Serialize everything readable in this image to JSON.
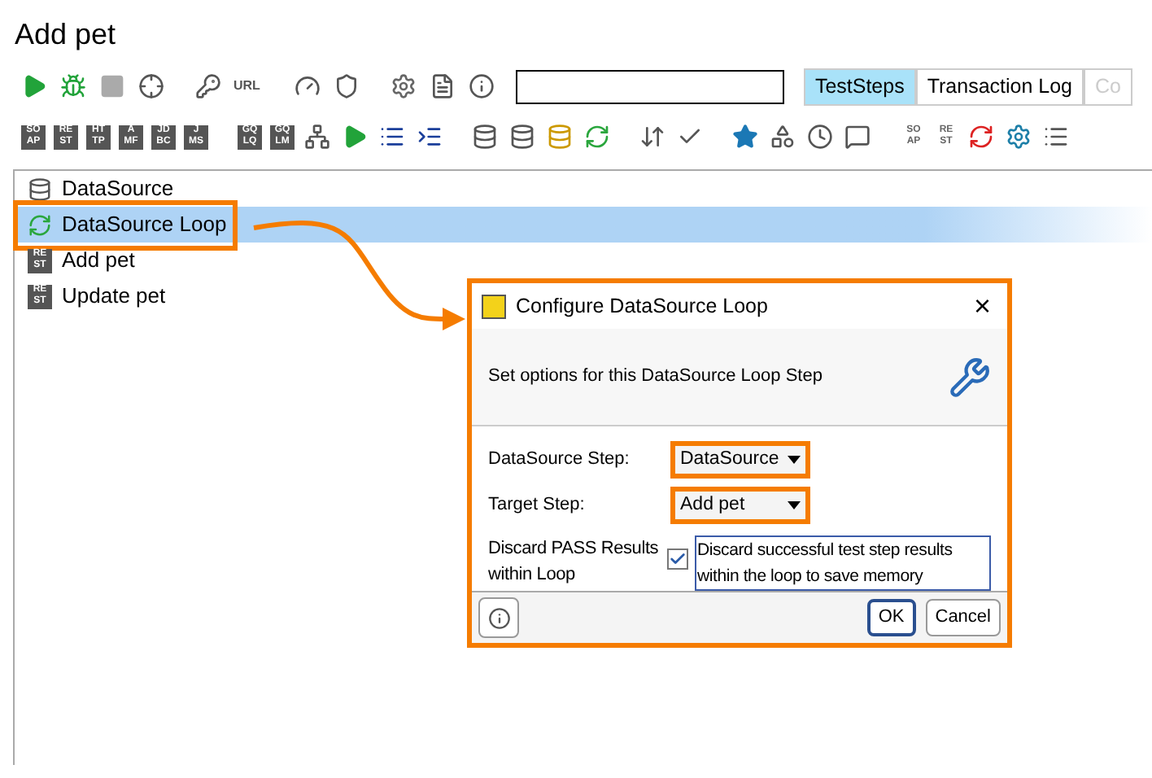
{
  "title": "Add pet",
  "toolbar": {
    "url_label": "URL",
    "tabs": [
      {
        "label": "TestSteps",
        "selected": true
      },
      {
        "label": "Transaction Log",
        "selected": false
      },
      {
        "label": "Co",
        "selected": false
      }
    ]
  },
  "format_badges": [
    [
      "SO",
      "AP"
    ],
    [
      "RE",
      "ST"
    ],
    [
      "HT",
      "TP"
    ],
    [
      "A",
      "MF"
    ],
    [
      "JD",
      "BC"
    ],
    [
      "J",
      "MS"
    ]
  ],
  "graphql_badges": [
    [
      "GQ",
      "LQ"
    ],
    [
      "GQ",
      "LM"
    ]
  ],
  "plain_badges": [
    [
      "SO",
      "AP"
    ],
    [
      "RE",
      "ST"
    ]
  ],
  "tree": [
    {
      "label": "DataSource",
      "kind": "datasource",
      "selected": false
    },
    {
      "label": "DataSource Loop",
      "kind": "loop",
      "selected": true
    },
    {
      "label": "Add pet",
      "kind": "rest",
      "badge": [
        "RE",
        "ST"
      ],
      "selected": false
    },
    {
      "label": "Update pet",
      "kind": "rest",
      "badge": [
        "RE",
        "ST"
      ],
      "selected": false
    }
  ],
  "dialog": {
    "title": "Configure DataSource Loop",
    "close": "×",
    "description": "Set options for this DataSource Loop Step",
    "fields": [
      {
        "label": "DataSource Step:",
        "value": "DataSource"
      },
      {
        "label": "Target Step:",
        "value": "Add pet"
      }
    ],
    "option": {
      "label": "Discard PASS Results within Loop",
      "checked": true,
      "text": "Discard successful test step results within the loop to save memory"
    },
    "buttons": [
      {
        "label": "OK",
        "selected": true
      },
      {
        "label": "Cancel",
        "selected": false
      }
    ]
  }
}
